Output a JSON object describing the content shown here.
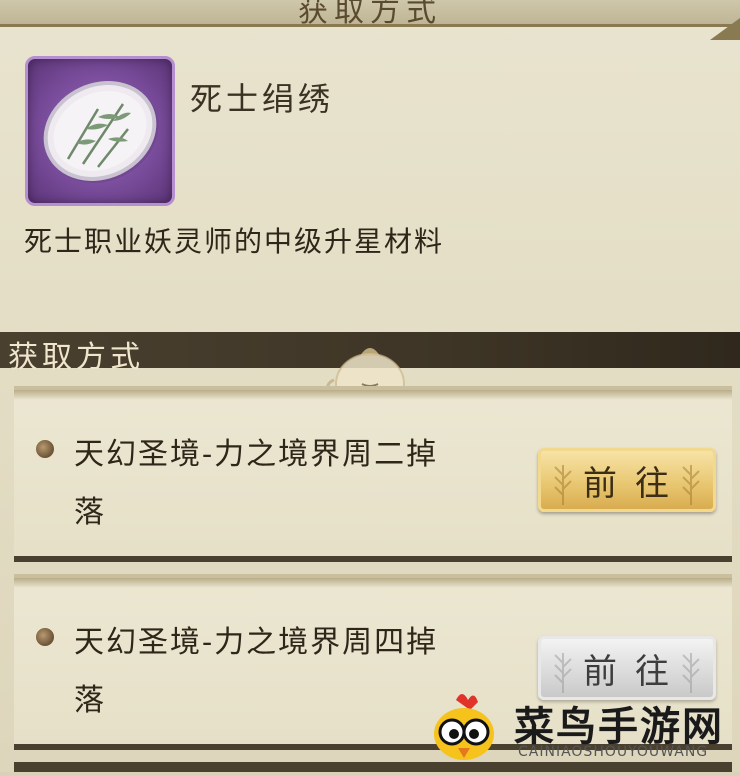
{
  "header": {
    "title": "获取方式"
  },
  "item": {
    "name": "死士绢绣",
    "description": "死士职业妖灵师的中级升星材料",
    "icon": "embroidered-silk-icon"
  },
  "section": {
    "title": "获取方式"
  },
  "sources": [
    {
      "text": "天幻圣境-力之境界周二掉落",
      "button_label": "前往",
      "button_style": "gold"
    },
    {
      "text": "天幻圣境-力之境界周四掉落",
      "button_label": "前往",
      "button_style": "grey"
    }
  ],
  "watermark": {
    "text": "菜鸟手游网",
    "subtext": "CAINIAOSHOUYOUWANG"
  },
  "colors": {
    "panel_bg": "#e9e4cf",
    "section_bar": "#3e3526",
    "icon_frame": "#7a4d9c",
    "button_gold": "#e9c873",
    "button_grey": "#dcdcdc"
  }
}
